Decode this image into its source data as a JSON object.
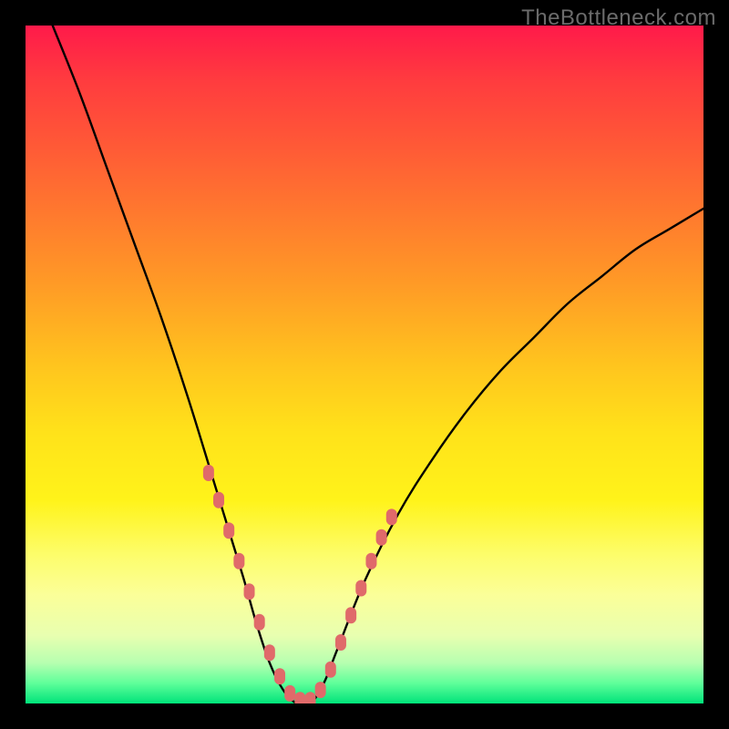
{
  "watermark": "TheBottleneck.com",
  "colors": {
    "frame": "#000000",
    "gradient_top": "#ff1a4a",
    "gradient_bottom": "#00e37a",
    "curve": "#000000",
    "marker": "#e06a6a"
  },
  "chart_data": {
    "type": "line",
    "title": "",
    "xlabel": "",
    "ylabel": "",
    "xlim": [
      0,
      100
    ],
    "ylim": [
      0,
      100
    ],
    "grid": false,
    "series": [
      {
        "name": "bottleneck-curve",
        "x": [
          4,
          8,
          12,
          16,
          20,
          24,
          28,
          32,
          34,
          36,
          38,
          40,
          42,
          44,
          46,
          50,
          55,
          60,
          65,
          70,
          75,
          80,
          85,
          90,
          95,
          100
        ],
        "y": [
          100,
          90,
          79,
          68,
          57,
          45,
          32,
          19,
          12,
          6,
          2,
          0,
          0,
          3,
          8,
          18,
          28,
          36,
          43,
          49,
          54,
          59,
          63,
          67,
          70,
          73
        ]
      }
    ],
    "markers": {
      "name": "highlight-dots",
      "x": [
        27,
        28.5,
        30,
        31.5,
        33,
        34.5,
        36,
        37.5,
        39,
        40.5,
        42,
        43.5,
        45,
        46.5,
        48,
        49.5,
        51,
        52.5,
        54
      ],
      "y": [
        34,
        30,
        25.5,
        21,
        16.5,
        12,
        7.5,
        4,
        1.5,
        0.5,
        0.5,
        2,
        5,
        9,
        13,
        17,
        21,
        24.5,
        27.5
      ]
    }
  }
}
